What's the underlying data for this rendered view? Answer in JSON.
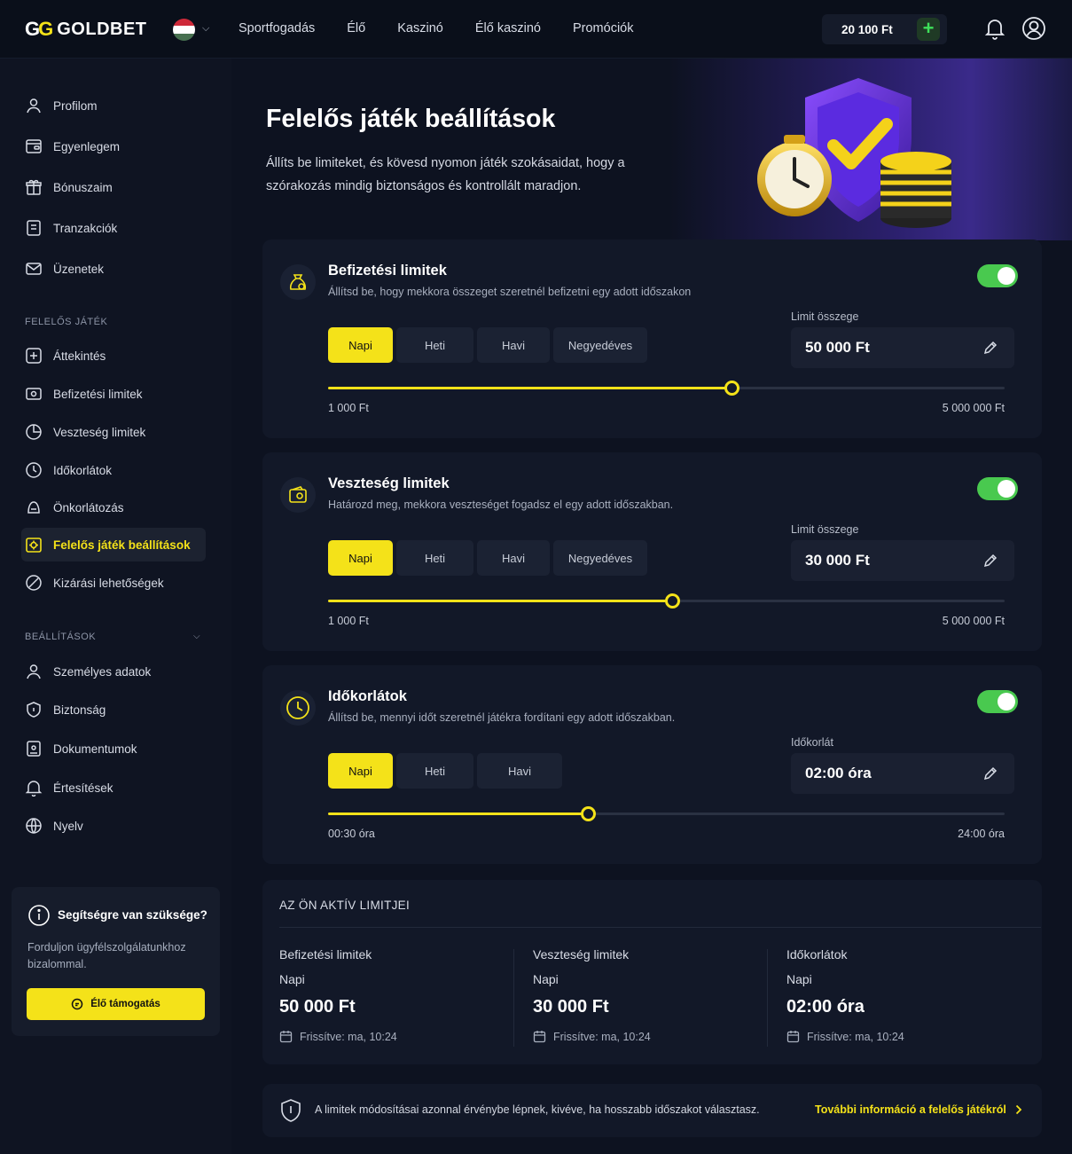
{
  "brand": {
    "logo_mark": "GG",
    "name": "GOLDBET"
  },
  "flag_colors": [
    "#ce2939",
    "#ffffff",
    "#477050"
  ],
  "nav": [
    "Sportfogadás",
    "Élő",
    "Kaszinó",
    "Élő kaszinó",
    "Promóciók"
  ],
  "balance": "20 100 Ft",
  "plus": "+",
  "sidebar": {
    "items": [
      "Profilom",
      "Egyenlegem",
      "Bónuszaim",
      "Tranzakciók",
      "Üzenetek"
    ],
    "section1": "FELELŐS JÁTÉK",
    "rg_items": [
      "Áttekintés",
      "Befizetési limitek",
      "Veszteség limitek",
      "Időkorlátok",
      "Önkorlátozás",
      "Felelős játék beállítások",
      "Kizárási lehetőségek"
    ],
    "section2": "BEÁLLÍTÁSOK",
    "settings_items": [
      "Személyes adatok",
      "Biztonság",
      "Dokumentumok",
      "Értesítések",
      "Nyelv"
    ]
  },
  "help": {
    "title": "Segítségre van szüksége?",
    "text": "Forduljon ügyfélszolgálatunkhoz bizalommal.",
    "button": "Élő támogatás"
  },
  "page": {
    "title": "Felelős játék beállítások",
    "subtitle": "Állíts be limiteket, és kövesd nyomon játék szokásaidat, hogy a szórakozás mindig biztonságos és kontrollált maradjon."
  },
  "cards": [
    {
      "title": "Befizetési limitek",
      "desc": "Állítsd be, hogy mekkora összeget szeretnél befizetni egy adott időszakon",
      "tabs": [
        "Napi",
        "Heti",
        "Havi",
        "Negyedéves"
      ],
      "active_tab": 0,
      "limit_label": "Limit összege",
      "limit_value": "50 000 Ft",
      "range_min": "1 000 Ft",
      "range_max": "5 000 000 Ft",
      "slider_fraction": 0.596,
      "enabled": true
    },
    {
      "title": "Veszteség limitek",
      "desc": "Határozd meg, mekkora veszteséget fogadsz el egy adott időszakban.",
      "tabs": [
        "Napi",
        "Heti",
        "Havi",
        "Negyedéves"
      ],
      "active_tab": 0,
      "limit_label": "Limit összege",
      "limit_value": "30 000 Ft",
      "range_min": "1 000 Ft",
      "range_max": "5 000 000 Ft",
      "slider_fraction": 0.508,
      "enabled": true
    },
    {
      "title": "Időkorlátok",
      "desc": "Állítsd be, mennyi időt szeretnél játékra fordítani egy adott időszakban.",
      "tabs": [
        "Napi",
        "Heti",
        "Havi"
      ],
      "active_tab": 0,
      "limit_label": "Időkorlát",
      "limit_value": "02:00 óra",
      "range_min": "00:30 óra",
      "range_max": "24:00 óra",
      "slider_fraction": 0.384,
      "enabled": true
    }
  ],
  "summary": {
    "heading": "AZ ÖN AKTÍV LIMITJEI",
    "cols": [
      {
        "title": "Befizetési limitek",
        "period": "Napi",
        "value": "50 000 Ft",
        "updated": "Frissítve: ma, 10:24"
      },
      {
        "title": "Veszteség limitek",
        "period": "Napi",
        "value": "30 000 Ft",
        "updated": "Frissítve: ma, 10:24"
      },
      {
        "title": "Időkorlátok",
        "period": "Napi",
        "value": "02:00 óra",
        "updated": "Frissítve: ma, 10:24"
      }
    ]
  },
  "notice": {
    "text": "A limitek módosításai azonnal érvénybe lépnek, kivéve, ha hosszabb időszakot választasz.",
    "link": "További információ a felelős játékról"
  },
  "colors": {
    "accent": "#f4e219",
    "toggle_on": "#49c94f",
    "bg": "#0d1220",
    "card": "#121828"
  }
}
